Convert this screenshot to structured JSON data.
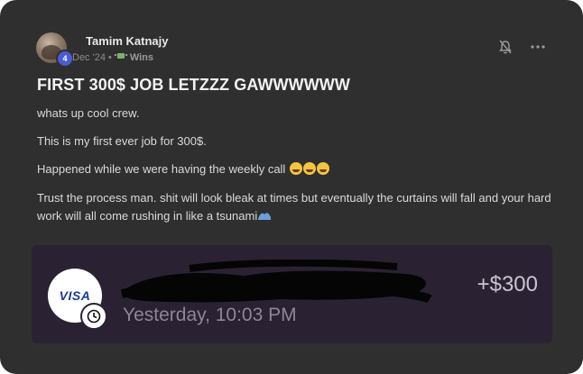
{
  "post": {
    "author": "Tamim Katnajy",
    "level": "4",
    "date": "Dec '24",
    "separator": "•",
    "category": "Wins",
    "category_icon": "money-with-wings",
    "title": "FIRST 300$ JOB LETZZZ GAWWWWWW",
    "paragraphs": [
      "whats up cool crew.",
      "This is my first ever job for 300$.",
      "Happened while we were having the weekly call",
      "Trust the process man. shit will look bleak at times but eventually the curtains will fall and your hard work will all come rushing in like a tsunami"
    ],
    "actions": {
      "bell_icon": "bell",
      "more_icon": "ellipsis"
    }
  },
  "transaction": {
    "card_brand": "VISA",
    "time": "Yesterday, 10:03 PM",
    "amount": "+$300",
    "pending_icon": "clock"
  },
  "colors": {
    "card_bg": "#2f2f2f",
    "receipt_bg": "#2a2232",
    "level_badge": "#4a5bd4",
    "visa_blue": "#1a3c9a"
  }
}
